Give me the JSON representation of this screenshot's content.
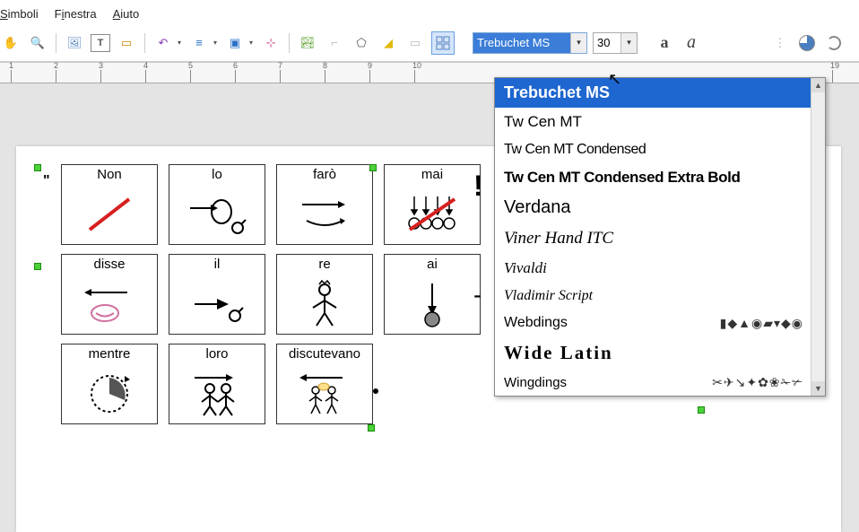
{
  "menu": {
    "simboli": "Simboli",
    "finestra": "Finestra",
    "aiuto": "Aiuto"
  },
  "toolbar": {
    "font_name": "Trebuchet MS",
    "font_size": "30"
  },
  "ruler": {
    "marks": [
      "1",
      "2",
      "3",
      "4",
      "5",
      "6",
      "7",
      "8",
      "9",
      "10",
      "19"
    ]
  },
  "symbols": [
    {
      "label": "Non"
    },
    {
      "label": "lo"
    },
    {
      "label": "farò"
    },
    {
      "label": "mai"
    },
    {
      "label": "disse"
    },
    {
      "label": "il"
    },
    {
      "label": "re"
    },
    {
      "label": "ai"
    },
    {
      "label": "mentre"
    },
    {
      "label": "loro"
    },
    {
      "label": "discutevano"
    }
  ],
  "font_dropdown": {
    "items": [
      {
        "name": "Trebuchet MS",
        "class": "selected"
      },
      {
        "name": "Tw Cen MT",
        "class": "twcen"
      },
      {
        "name": "Tw Cen MT Condensed",
        "class": "twcenc"
      },
      {
        "name": "Tw Cen MT Condensed Extra Bold",
        "class": "twcenb"
      },
      {
        "name": "Verdana",
        "class": "verdana"
      },
      {
        "name": "Viner Hand ITC",
        "class": "viner"
      },
      {
        "name": "Vivaldi",
        "class": "vivaldi"
      },
      {
        "name": "Vladimir Script",
        "class": "vlad"
      },
      {
        "name": "Webdings",
        "class": "webd",
        "preview": "▮◆▲◉▰▾◆◉"
      },
      {
        "name": "Wide Latin",
        "class": "wide"
      },
      {
        "name": "Wingdings",
        "class": "wing",
        "preview": "✂✈↘✦✿❀✁✃"
      }
    ]
  }
}
